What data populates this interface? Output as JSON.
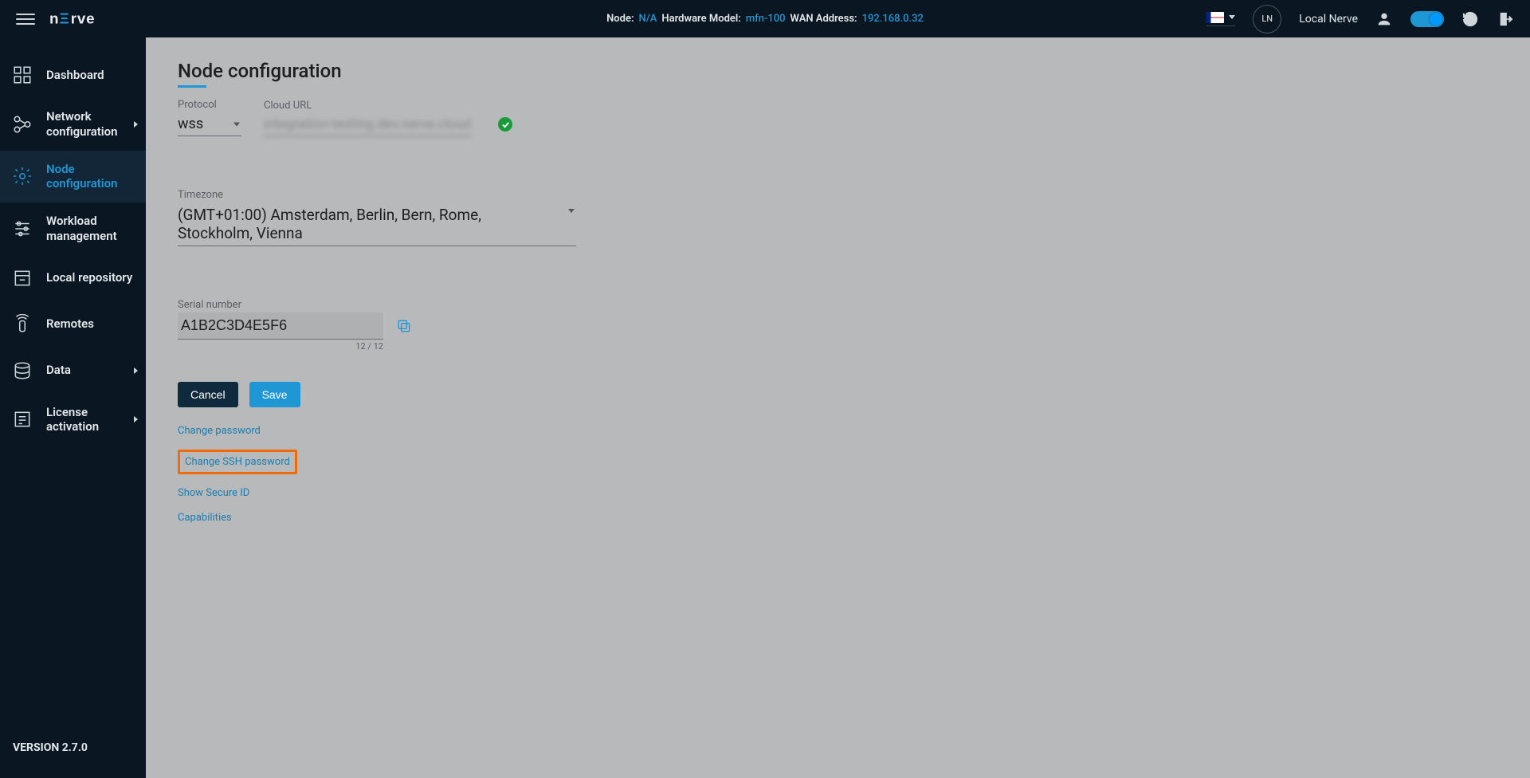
{
  "header": {
    "node_label": "Node:",
    "node_value": "N/A",
    "hw_label": "Hardware Model:",
    "hw_value": "mfn-100",
    "wan_label": "WAN Address:",
    "wan_value": "192.168.0.32",
    "avatar_initials": "LN",
    "user_label": "Local Nerve"
  },
  "sidebar": {
    "items": [
      {
        "label": "Dashboard"
      },
      {
        "label": "Network configuration"
      },
      {
        "label": "Node configuration"
      },
      {
        "label": "Workload management"
      },
      {
        "label": "Local repository"
      },
      {
        "label": "Remotes"
      },
      {
        "label": "Data"
      },
      {
        "label": "License activation"
      }
    ],
    "version": "VERSION 2.7.0"
  },
  "page": {
    "title": "Node configuration",
    "protocol_label": "Protocol",
    "protocol_value": "wss",
    "cloudurl_label": "Cloud URL",
    "cloudurl_value": "integration-testing.dev.nerve.cloud",
    "timezone_label": "Timezone",
    "timezone_value": "(GMT+01:00) Amsterdam, Berlin, Bern, Rome, Stockholm, Vienna",
    "serial_label": "Serial number",
    "serial_value": "A1B2C3D4E5F6",
    "serial_counter": "12 / 12",
    "cancel_label": "Cancel",
    "save_label": "Save",
    "links": {
      "change_password": "Change password",
      "change_ssh_password": "Change SSH password",
      "show_secure_id": "Show Secure ID",
      "capabilities": "Capabilities"
    }
  }
}
